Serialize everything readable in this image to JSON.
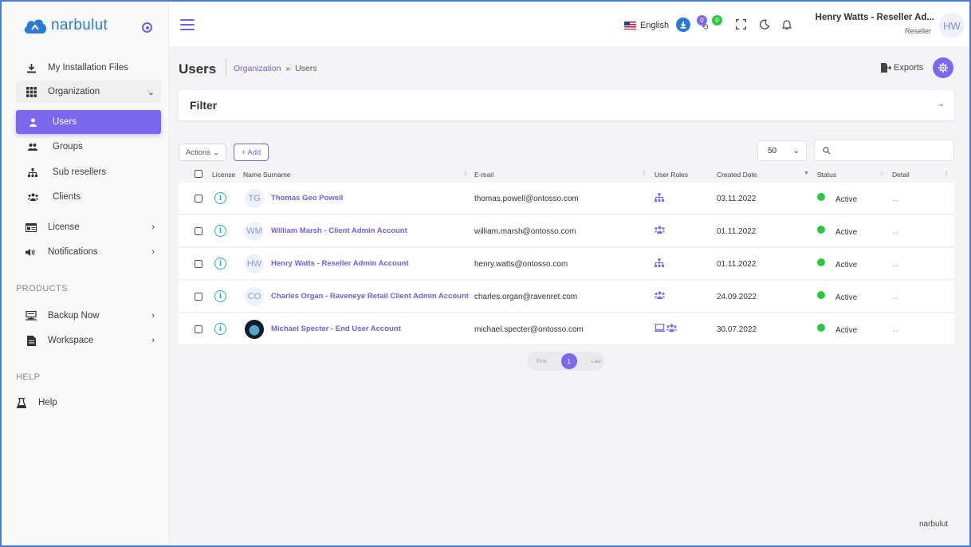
{
  "brand": {
    "logo_text": "narbulut",
    "footer_text": "narbulut"
  },
  "sidebar": {
    "my_files": "My Installation Files",
    "organization": "Organization",
    "org_items": [
      {
        "label": "Users",
        "icon": "user-icon",
        "active": true
      },
      {
        "label": "Groups",
        "icon": "group-icon"
      },
      {
        "label": "Sub resellers",
        "icon": "hierarchy-icon"
      },
      {
        "label": "Clients",
        "icon": "clients-icon"
      }
    ],
    "license": "License",
    "notifications": "Notifications",
    "products_title": "PRODUCTS",
    "backup_now": "Backup Now",
    "workspace": "Workspace",
    "help_title": "HELP",
    "help": "Help"
  },
  "topbar": {
    "language": "English",
    "badge_notify_1": "0",
    "badge_notify_2": "0",
    "user_name": "Henry Watts - Reseller Ad...",
    "user_role": "Reseller",
    "user_initials": "HW"
  },
  "page": {
    "title": "Users",
    "breadcrumb_link": "Organization",
    "breadcrumb_sep": "»",
    "breadcrumb_current": "Users",
    "exports_label": "Exports",
    "filter_label": "Filter",
    "actions_label": "Actions",
    "add_label": "+ Add",
    "page_size": "50"
  },
  "table": {
    "headers": {
      "license": "License",
      "name": "Name Surname",
      "email": "E-mail",
      "roles": "User Roles",
      "created": "Created Date",
      "status": "Status",
      "detail": "Detail"
    },
    "rows": [
      {
        "initials": "TG",
        "name": "Thomas Geo Powell",
        "email": "thomas.powell@ontosso.com",
        "roles": [
          "hierarchy-icon"
        ],
        "created": "03.11.2022",
        "status": "Active",
        "detail": "...",
        "avatar_photo": false
      },
      {
        "initials": "WM",
        "name": "William Marsh - Client Admin Account",
        "email": "william.marsh@ontosso.com",
        "roles": [
          "clients-icon"
        ],
        "created": "01.11.2022",
        "status": "Active",
        "detail": "...",
        "avatar_photo": false
      },
      {
        "initials": "HW",
        "name": "Henry Watts - Reseller Admin Account",
        "email": "henry.watts@ontosso.com",
        "roles": [
          "hierarchy-icon"
        ],
        "created": "01.11.2022",
        "status": "Active",
        "detail": "...",
        "avatar_photo": false
      },
      {
        "initials": "CO",
        "name": "Charles Organ - Raveneye Retail Client Admin Account",
        "email": "charles.organ@ravenret.com",
        "roles": [
          "clients-icon"
        ],
        "created": "24.09.2022",
        "status": "Active",
        "detail": "...",
        "avatar_photo": false
      },
      {
        "initials": "",
        "name": "Michael Specter - End User Account",
        "email": "michael.specter@ontosso.com",
        "roles": [
          "laptop-icon",
          "clients-icon"
        ],
        "created": "30.07.2022",
        "status": "Active",
        "detail": "...",
        "avatar_photo": true
      }
    ]
  },
  "pagination": {
    "first": "First",
    "current": "1",
    "last": "Last"
  },
  "colors": {
    "accent": "#7b68ee",
    "active_status": "#28c840",
    "info": "#20b2aa",
    "brand_blue": "#2a7bd4"
  }
}
